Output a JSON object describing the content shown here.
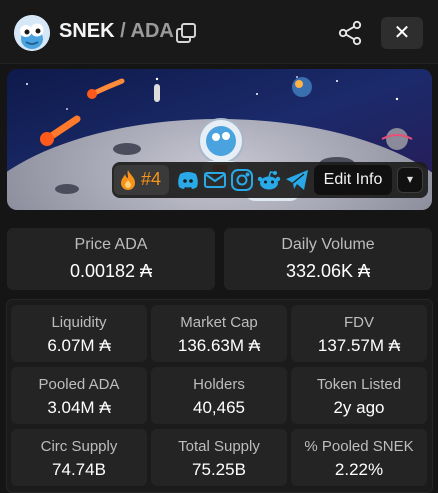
{
  "header": {
    "base_token": "SNEK",
    "separator": "/",
    "quote_token": "ADA",
    "icons": {
      "avatar": "snek-logo",
      "copy": "copy-icon",
      "share": "share-icon",
      "close": "close-icon"
    },
    "close_label": "✕"
  },
  "banner": {
    "rank_label": "#4",
    "rank_icon": "fire-icon",
    "social_icons": [
      "discord-icon",
      "email-icon",
      "instagram-icon",
      "reddit-icon",
      "telegram-icon"
    ],
    "edit_info_label": "Edit Info",
    "dropdown_icon": "chevron-down-icon"
  },
  "top_stats": [
    {
      "label": "Price ADA",
      "value": "0.00182 ₳"
    },
    {
      "label": "Daily Volume",
      "value": "332.06K ₳"
    }
  ],
  "stats_grid": [
    {
      "label": "Liquidity",
      "value": "6.07M ₳"
    },
    {
      "label": "Market Cap",
      "value": "136.63M ₳"
    },
    {
      "label": "FDV",
      "value": "137.57M ₳"
    },
    {
      "label": "Pooled ADA",
      "value": "3.04M ₳"
    },
    {
      "label": "Holders",
      "value": "40,465"
    },
    {
      "label": "Token Listed",
      "value": "2y ago"
    },
    {
      "label": "Circ Supply",
      "value": "74.74B"
    },
    {
      "label": "Total Supply",
      "value": "75.25B"
    },
    {
      "label": "% Pooled SNEK",
      "value": "2.22%"
    }
  ],
  "colors": {
    "background": "#151515",
    "card": "#232323",
    "accent": "#f7931a",
    "social": "#29a9e8"
  }
}
